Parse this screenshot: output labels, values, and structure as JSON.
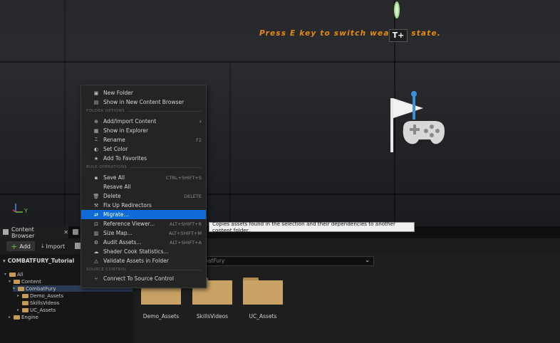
{
  "viewport": {
    "hint_text": "Press E key to switch weapon state.",
    "tplus_label": "T+",
    "axis_label": "Y"
  },
  "context_menu": {
    "top_items": [
      {
        "label": "New Folder",
        "icon": "new-folder-icon"
      },
      {
        "label": "Show in New Content Browser",
        "icon": "content-browser-icon"
      }
    ],
    "folder_options_title": "FOLDER OPTIONS",
    "folder_options": [
      {
        "label": "Add/Import Content",
        "icon": "import-icon",
        "submenu": true
      },
      {
        "label": "Show in Explorer",
        "icon": "explorer-icon"
      },
      {
        "label": "Rename",
        "icon": "rename-icon",
        "shortcut": "F2"
      },
      {
        "label": "Set Color",
        "icon": "color-icon"
      },
      {
        "label": "Add To Favorites",
        "icon": "star-icon"
      }
    ],
    "bulk_operations_title": "BULK OPERATIONS",
    "bulk_operations": [
      {
        "label": "Save All",
        "icon": "save-icon",
        "shortcut": "CTRL+SHIFT+S"
      },
      {
        "label": "Resave All",
        "icon": "resave-icon"
      },
      {
        "label": "Delete",
        "icon": "trash-icon",
        "shortcut": "DELETE"
      },
      {
        "label": "Fix Up Redirectors",
        "icon": "wrench-icon"
      },
      {
        "label": "Migrate...",
        "icon": "migrate-icon",
        "highlighted": true
      },
      {
        "label": "Reference Viewer...",
        "icon": "reference-viewer-icon",
        "shortcut": "ALT+SHIFT+R"
      },
      {
        "label": "Size Map...",
        "icon": "size-map-icon",
        "shortcut": "ALT+SHIFT+M"
      },
      {
        "label": "Audit Assets...",
        "icon": "audit-icon",
        "shortcut": "ALT+SHIFT+A"
      },
      {
        "label": "Shader Cook Statistics...",
        "icon": "shader-icon"
      },
      {
        "label": "Validate Assets in Folder",
        "icon": "validate-icon"
      }
    ],
    "source_control_title": "SOURCE CONTROL",
    "source_control": [
      {
        "label": "Connect To Source Control",
        "icon": "source-control-icon"
      }
    ]
  },
  "tooltip": "Copies assets found in the selection and their dependencies to another content folder.",
  "content_browser": {
    "tab_label": "Content Browser",
    "add_label": "Add",
    "import_label": "Import",
    "path_tail": "mbatFury",
    "filter_placeholder": "batFury",
    "project_title": "COMBATFURY_Tutorial",
    "tree": [
      {
        "label": "All",
        "level": 0
      },
      {
        "label": "Content",
        "level": 1
      },
      {
        "label": "CombatFury",
        "level": 2,
        "selected": true
      },
      {
        "label": "Demo_Assets",
        "level": 3
      },
      {
        "label": "SkillsVideos",
        "level": 3
      },
      {
        "label": "UC_Assets",
        "level": 3
      },
      {
        "label": "Engine",
        "level": 1
      }
    ],
    "folders": [
      "Demo_Assets",
      "SkillsVideos",
      "UC_Assets"
    ]
  }
}
